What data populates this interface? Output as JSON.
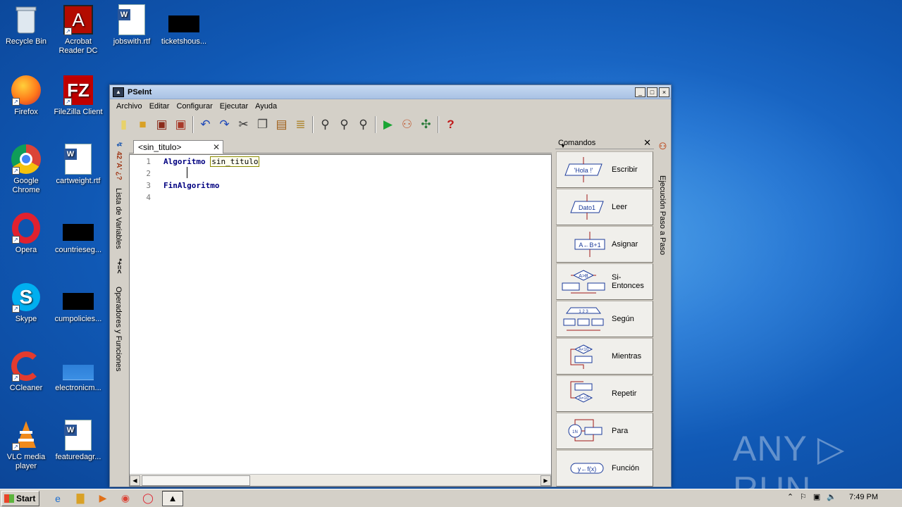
{
  "desktop": {
    "icons": [
      {
        "label": "Recycle Bin"
      },
      {
        "label": "Acrobat Reader DC"
      },
      {
        "label": "jobswith.rtf"
      },
      {
        "label": "ticketshous..."
      },
      {
        "label": "Firefox"
      },
      {
        "label": "FileZilla Client"
      },
      {
        "label": "Google Chrome"
      },
      {
        "label": "cartweight.rtf"
      },
      {
        "label": "Opera"
      },
      {
        "label": "countrieseg..."
      },
      {
        "label": "Skype"
      },
      {
        "label": "cumpolicies..."
      },
      {
        "label": "CCleaner"
      },
      {
        "label": "electronicm..."
      },
      {
        "label": "VLC media player"
      },
      {
        "label": "featuredagr..."
      }
    ]
  },
  "window": {
    "title": "PSeInt",
    "menu": [
      "Archivo",
      "Editar",
      "Configurar",
      "Ejecutar",
      "Ayuda"
    ],
    "tab_label": "<sin_titulo>",
    "left_panel": {
      "variables_label": "Lista de Variables",
      "operators_label": "Operadores y Funciones"
    },
    "right_panel": {
      "step_label": "Ejecución Paso a Paso"
    },
    "code_lines": [
      {
        "num": "1",
        "kw": "Algoritmo",
        "ident": "sin_titulo"
      },
      {
        "num": "2",
        "kw": "",
        "ident": ""
      },
      {
        "num": "3",
        "kw": "FinAlgoritmo",
        "ident": ""
      },
      {
        "num": "4",
        "kw": "",
        "ident": ""
      }
    ],
    "commands": {
      "title": "Comandos",
      "items": [
        {
          "label": "Escribir",
          "icon_text": "'Hola !'"
        },
        {
          "label": "Leer",
          "icon_text": "Dato1"
        },
        {
          "label": "Asignar",
          "icon_text": "A←B+1"
        },
        {
          "label": "Si-Entonces",
          "icon_text": "A>B"
        },
        {
          "label": "Según",
          "icon_text": "1 2 3"
        },
        {
          "label": "Mientras",
          "icon_text": "A<10"
        },
        {
          "label": "Repetir",
          "icon_text": "A=10"
        },
        {
          "label": "Para",
          "icon_text": "1N"
        },
        {
          "label": "Función",
          "icon_text": "y←f(x)"
        }
      ]
    }
  },
  "taskbar": {
    "start_label": "Start",
    "clock": "7:49 PM"
  },
  "watermark": "ANY ▷ RUN"
}
